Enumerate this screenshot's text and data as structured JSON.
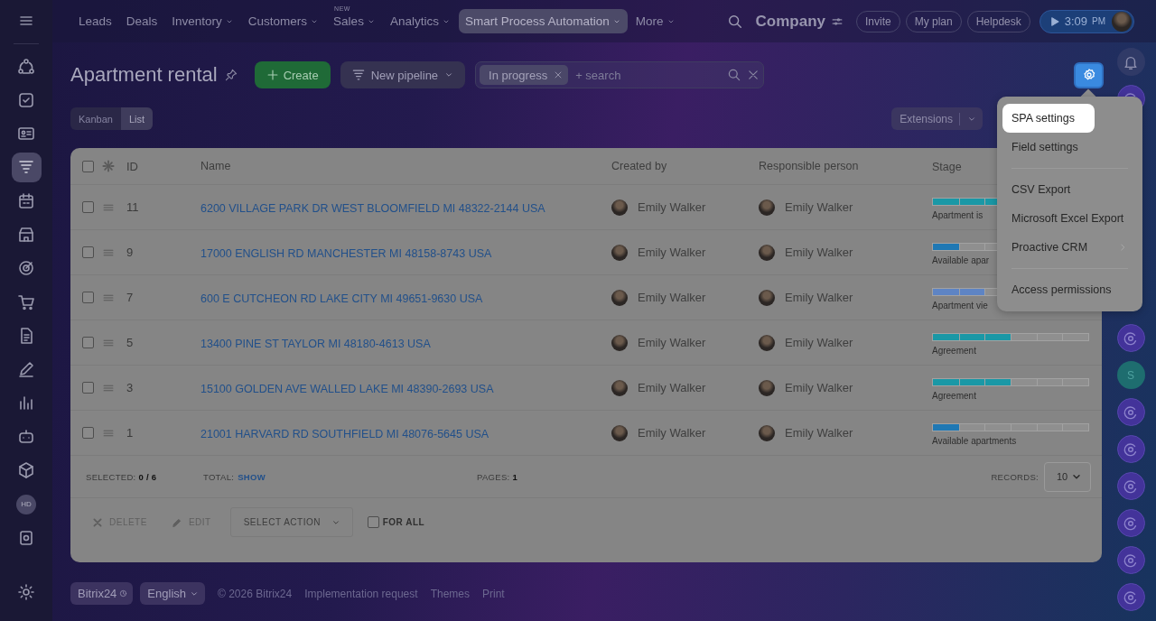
{
  "top_nav": {
    "items": [
      {
        "label": "Leads",
        "dropdown": false,
        "selected": false
      },
      {
        "label": "Deals",
        "dropdown": false,
        "selected": false
      },
      {
        "label": "Inventory",
        "dropdown": true,
        "selected": false
      },
      {
        "label": "Customers",
        "dropdown": true,
        "selected": false
      },
      {
        "label": "Sales",
        "dropdown": true,
        "selected": false,
        "badge": "NEW"
      },
      {
        "label": "Analytics",
        "dropdown": true,
        "selected": false
      },
      {
        "label": "Smart Process Automation",
        "dropdown": true,
        "selected": true
      },
      {
        "label": "More",
        "dropdown": true,
        "selected": false
      }
    ],
    "company": "Company",
    "buttons": [
      "Invite",
      "My plan",
      "Helpdesk"
    ],
    "clock": {
      "time": "3:09",
      "suffix": "PM"
    }
  },
  "left_bar": {
    "items": [
      {
        "kind": "share",
        "selected": false
      },
      {
        "kind": "task",
        "selected": false
      },
      {
        "kind": "card",
        "selected": false
      },
      {
        "kind": "funnel",
        "selected": true
      },
      {
        "kind": "calendar",
        "selected": false
      },
      {
        "kind": "store",
        "selected": false
      },
      {
        "kind": "target",
        "selected": false
      },
      {
        "kind": "cart",
        "selected": false
      },
      {
        "kind": "doc",
        "selected": false
      },
      {
        "kind": "pen",
        "selected": false
      },
      {
        "kind": "chart",
        "selected": false
      },
      {
        "kind": "robot",
        "selected": false
      },
      {
        "kind": "cube",
        "selected": false
      },
      {
        "kind": "initials",
        "text": "HD",
        "selected": false
      },
      {
        "kind": "box",
        "selected": false
      }
    ]
  },
  "page": {
    "title": "Apartment rental",
    "create": "Create",
    "pipeline": "New pipeline",
    "filter": {
      "tag": "In progress",
      "placeholder": "+ search"
    },
    "extensions": "Extensions"
  },
  "views": [
    {
      "label": "Kanban",
      "selected": false
    },
    {
      "label": "List",
      "selected": true
    }
  ],
  "table": {
    "header_checked": false,
    "columns": [
      "ID",
      "Name",
      "Created by",
      "Responsible person",
      "Stage"
    ],
    "rows": [
      {
        "checked": false,
        "id": "11",
        "name": "6200 VILLAGE PARK DR WEST BLOOMFIELD MI 48322-2144 USA",
        "created_by": "Emily Walker",
        "responsible": "Emily Walker",
        "stage": {
          "label": "Apartment is",
          "level": 0.67,
          "color": "#1a98a6"
        }
      },
      {
        "checked": false,
        "id": "9",
        "name": "17000 ENGLISH RD MANCHESTER MI 48158-8743 USA",
        "created_by": "Emily Walker",
        "responsible": "Emily Walker",
        "stage": {
          "label": "Available apar",
          "level": 0.17,
          "color": "#1f78b4"
        }
      },
      {
        "checked": false,
        "id": "7",
        "name": "600 E CUTCHEON RD LAKE CITY MI 49651-9630 USA",
        "created_by": "Emily Walker",
        "responsible": "Emily Walker",
        "stage": {
          "label": "Apartment vie",
          "level": 0.33,
          "color": "#5e84c4"
        }
      },
      {
        "checked": false,
        "id": "5",
        "name": "13400 PINE ST TAYLOR MI 48180-4613 USA",
        "created_by": "Emily Walker",
        "responsible": "Emily Walker",
        "stage": {
          "label": "Agreement",
          "level": 0.5,
          "color": "#1a98a6"
        }
      },
      {
        "checked": false,
        "id": "3",
        "name": "15100 GOLDEN AVE WALLED LAKE MI 48390-2693 USA",
        "created_by": "Emily Walker",
        "responsible": "Emily Walker",
        "stage": {
          "label": "Agreement",
          "level": 0.5,
          "color": "#1a98a6"
        }
      },
      {
        "checked": false,
        "id": "1",
        "name": "21001 HARVARD RD SOUTHFIELD MI 48076-5645 USA",
        "created_by": "Emily Walker",
        "responsible": "Emily Walker",
        "stage": {
          "label": "Available apartments",
          "level": 0.17,
          "color": "#1f78b4"
        }
      }
    ]
  },
  "stats": {
    "selected_label": "SELECTED:",
    "selected_value": "0 / 6",
    "total_label": "TOTAL:",
    "total_link": "SHOW",
    "pages_label": "PAGES:",
    "pages_value": "1",
    "records_label": "RECORDS:",
    "records_value": "10"
  },
  "actions": {
    "delete": "DELETE",
    "edit": "EDIT",
    "select": "SELECT ACTION",
    "for_all": {
      "label": "FOR ALL",
      "checked": false
    }
  },
  "settings_menu": {
    "groups": [
      [
        {
          "label": "SPA settings",
          "selected": true,
          "submenu": false
        },
        {
          "label": "Field settings",
          "selected": false,
          "submenu": false
        }
      ],
      [
        {
          "label": "CSV Export",
          "selected": false,
          "submenu": false
        },
        {
          "label": "Microsoft Excel Export",
          "selected": false,
          "submenu": false
        },
        {
          "label": "Proactive CRM",
          "selected": false,
          "submenu": true
        }
      ],
      [
        {
          "label": "Access permissions",
          "selected": false,
          "submenu": false
        }
      ]
    ]
  },
  "right_bar": {
    "top": [
      {
        "kind": "bell"
      },
      {
        "kind": "app"
      }
    ],
    "bottom": [
      {
        "kind": "app"
      },
      {
        "kind": "letter",
        "text": "S"
      },
      {
        "kind": "app"
      },
      {
        "kind": "app"
      },
      {
        "kind": "app"
      },
      {
        "kind": "app"
      },
      {
        "kind": "app"
      },
      {
        "kind": "app"
      }
    ]
  },
  "footer": {
    "brand": "Bitrix24",
    "language": "English",
    "copyright": "© 2026 Bitrix24",
    "links": [
      "Implementation request",
      "Themes",
      "Print"
    ]
  }
}
